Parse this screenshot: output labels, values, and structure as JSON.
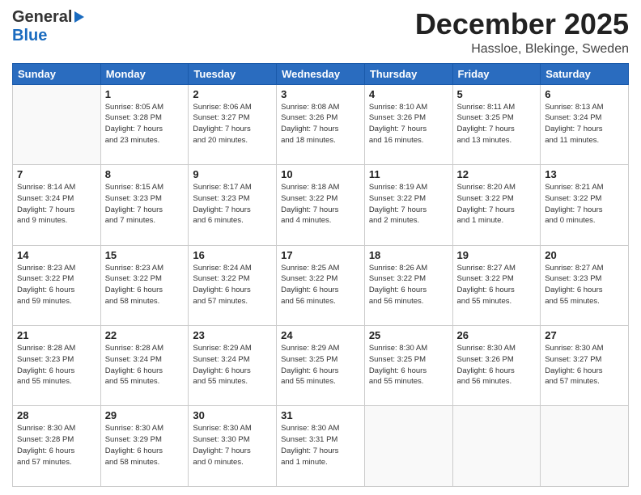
{
  "header": {
    "logo_line1": "General",
    "logo_line2": "Blue",
    "month": "December 2025",
    "location": "Hassloe, Blekinge, Sweden"
  },
  "days_of_week": [
    "Sunday",
    "Monday",
    "Tuesday",
    "Wednesday",
    "Thursday",
    "Friday",
    "Saturday"
  ],
  "weeks": [
    [
      {
        "day": "",
        "info": ""
      },
      {
        "day": "1",
        "info": "Sunrise: 8:05 AM\nSunset: 3:28 PM\nDaylight: 7 hours\nand 23 minutes."
      },
      {
        "day": "2",
        "info": "Sunrise: 8:06 AM\nSunset: 3:27 PM\nDaylight: 7 hours\nand 20 minutes."
      },
      {
        "day": "3",
        "info": "Sunrise: 8:08 AM\nSunset: 3:26 PM\nDaylight: 7 hours\nand 18 minutes."
      },
      {
        "day": "4",
        "info": "Sunrise: 8:10 AM\nSunset: 3:26 PM\nDaylight: 7 hours\nand 16 minutes."
      },
      {
        "day": "5",
        "info": "Sunrise: 8:11 AM\nSunset: 3:25 PM\nDaylight: 7 hours\nand 13 minutes."
      },
      {
        "day": "6",
        "info": "Sunrise: 8:13 AM\nSunset: 3:24 PM\nDaylight: 7 hours\nand 11 minutes."
      }
    ],
    [
      {
        "day": "7",
        "info": "Sunrise: 8:14 AM\nSunset: 3:24 PM\nDaylight: 7 hours\nand 9 minutes."
      },
      {
        "day": "8",
        "info": "Sunrise: 8:15 AM\nSunset: 3:23 PM\nDaylight: 7 hours\nand 7 minutes."
      },
      {
        "day": "9",
        "info": "Sunrise: 8:17 AM\nSunset: 3:23 PM\nDaylight: 7 hours\nand 6 minutes."
      },
      {
        "day": "10",
        "info": "Sunrise: 8:18 AM\nSunset: 3:22 PM\nDaylight: 7 hours\nand 4 minutes."
      },
      {
        "day": "11",
        "info": "Sunrise: 8:19 AM\nSunset: 3:22 PM\nDaylight: 7 hours\nand 2 minutes."
      },
      {
        "day": "12",
        "info": "Sunrise: 8:20 AM\nSunset: 3:22 PM\nDaylight: 7 hours\nand 1 minute."
      },
      {
        "day": "13",
        "info": "Sunrise: 8:21 AM\nSunset: 3:22 PM\nDaylight: 7 hours\nand 0 minutes."
      }
    ],
    [
      {
        "day": "14",
        "info": "Sunrise: 8:23 AM\nSunset: 3:22 PM\nDaylight: 6 hours\nand 59 minutes."
      },
      {
        "day": "15",
        "info": "Sunrise: 8:23 AM\nSunset: 3:22 PM\nDaylight: 6 hours\nand 58 minutes."
      },
      {
        "day": "16",
        "info": "Sunrise: 8:24 AM\nSunset: 3:22 PM\nDaylight: 6 hours\nand 57 minutes."
      },
      {
        "day": "17",
        "info": "Sunrise: 8:25 AM\nSunset: 3:22 PM\nDaylight: 6 hours\nand 56 minutes."
      },
      {
        "day": "18",
        "info": "Sunrise: 8:26 AM\nSunset: 3:22 PM\nDaylight: 6 hours\nand 56 minutes."
      },
      {
        "day": "19",
        "info": "Sunrise: 8:27 AM\nSunset: 3:22 PM\nDaylight: 6 hours\nand 55 minutes."
      },
      {
        "day": "20",
        "info": "Sunrise: 8:27 AM\nSunset: 3:23 PM\nDaylight: 6 hours\nand 55 minutes."
      }
    ],
    [
      {
        "day": "21",
        "info": "Sunrise: 8:28 AM\nSunset: 3:23 PM\nDaylight: 6 hours\nand 55 minutes."
      },
      {
        "day": "22",
        "info": "Sunrise: 8:28 AM\nSunset: 3:24 PM\nDaylight: 6 hours\nand 55 minutes."
      },
      {
        "day": "23",
        "info": "Sunrise: 8:29 AM\nSunset: 3:24 PM\nDaylight: 6 hours\nand 55 minutes."
      },
      {
        "day": "24",
        "info": "Sunrise: 8:29 AM\nSunset: 3:25 PM\nDaylight: 6 hours\nand 55 minutes."
      },
      {
        "day": "25",
        "info": "Sunrise: 8:30 AM\nSunset: 3:25 PM\nDaylight: 6 hours\nand 55 minutes."
      },
      {
        "day": "26",
        "info": "Sunrise: 8:30 AM\nSunset: 3:26 PM\nDaylight: 6 hours\nand 56 minutes."
      },
      {
        "day": "27",
        "info": "Sunrise: 8:30 AM\nSunset: 3:27 PM\nDaylight: 6 hours\nand 57 minutes."
      }
    ],
    [
      {
        "day": "28",
        "info": "Sunrise: 8:30 AM\nSunset: 3:28 PM\nDaylight: 6 hours\nand 57 minutes."
      },
      {
        "day": "29",
        "info": "Sunrise: 8:30 AM\nSunset: 3:29 PM\nDaylight: 6 hours\nand 58 minutes."
      },
      {
        "day": "30",
        "info": "Sunrise: 8:30 AM\nSunset: 3:30 PM\nDaylight: 7 hours\nand 0 minutes."
      },
      {
        "day": "31",
        "info": "Sunrise: 8:30 AM\nSunset: 3:31 PM\nDaylight: 7 hours\nand 1 minute."
      },
      {
        "day": "",
        "info": ""
      },
      {
        "day": "",
        "info": ""
      },
      {
        "day": "",
        "info": ""
      }
    ]
  ]
}
